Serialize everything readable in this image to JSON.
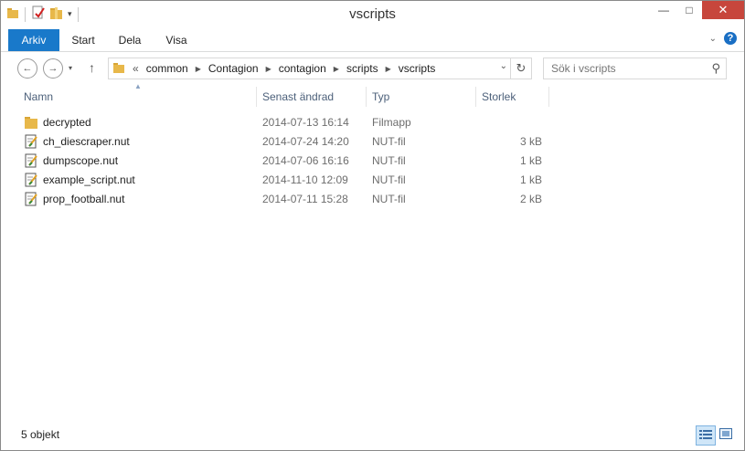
{
  "window": {
    "title": "vscripts"
  },
  "ribbon": {
    "tabs": [
      {
        "label": "Arkiv"
      },
      {
        "label": "Start"
      },
      {
        "label": "Dela"
      },
      {
        "label": "Visa"
      }
    ]
  },
  "nav": {
    "overflow": "«",
    "breadcrumbs": [
      "common",
      "Contagion",
      "contagion",
      "scripts",
      "vscripts"
    ],
    "search_placeholder": "Sök i vscripts"
  },
  "columns": {
    "name": "Namn",
    "modified": "Senast ändrad",
    "type": "Typ",
    "size": "Storlek"
  },
  "files": [
    {
      "name": "decrypted",
      "modified": "2014-07-13 16:14",
      "type": "Filmapp",
      "size": "",
      "icon": "folder-icon"
    },
    {
      "name": "ch_diescraper.nut",
      "modified": "2014-07-24 14:20",
      "type": "NUT-fil",
      "size": "3 kB",
      "icon": "script-file-icon"
    },
    {
      "name": "dumpscope.nut",
      "modified": "2014-07-06 16:16",
      "type": "NUT-fil",
      "size": "1 kB",
      "icon": "script-file-icon"
    },
    {
      "name": "example_script.nut",
      "modified": "2014-11-10 12:09",
      "type": "NUT-fil",
      "size": "1 kB",
      "icon": "script-file-icon"
    },
    {
      "name": "prop_football.nut",
      "modified": "2014-07-11 15:28",
      "type": "NUT-fil",
      "size": "2 kB",
      "icon": "script-file-icon"
    }
  ],
  "status": {
    "count": "5 objekt"
  },
  "colors": {
    "accent": "#1979ca",
    "close": "#c7463c",
    "folder": "#e8b84a"
  }
}
